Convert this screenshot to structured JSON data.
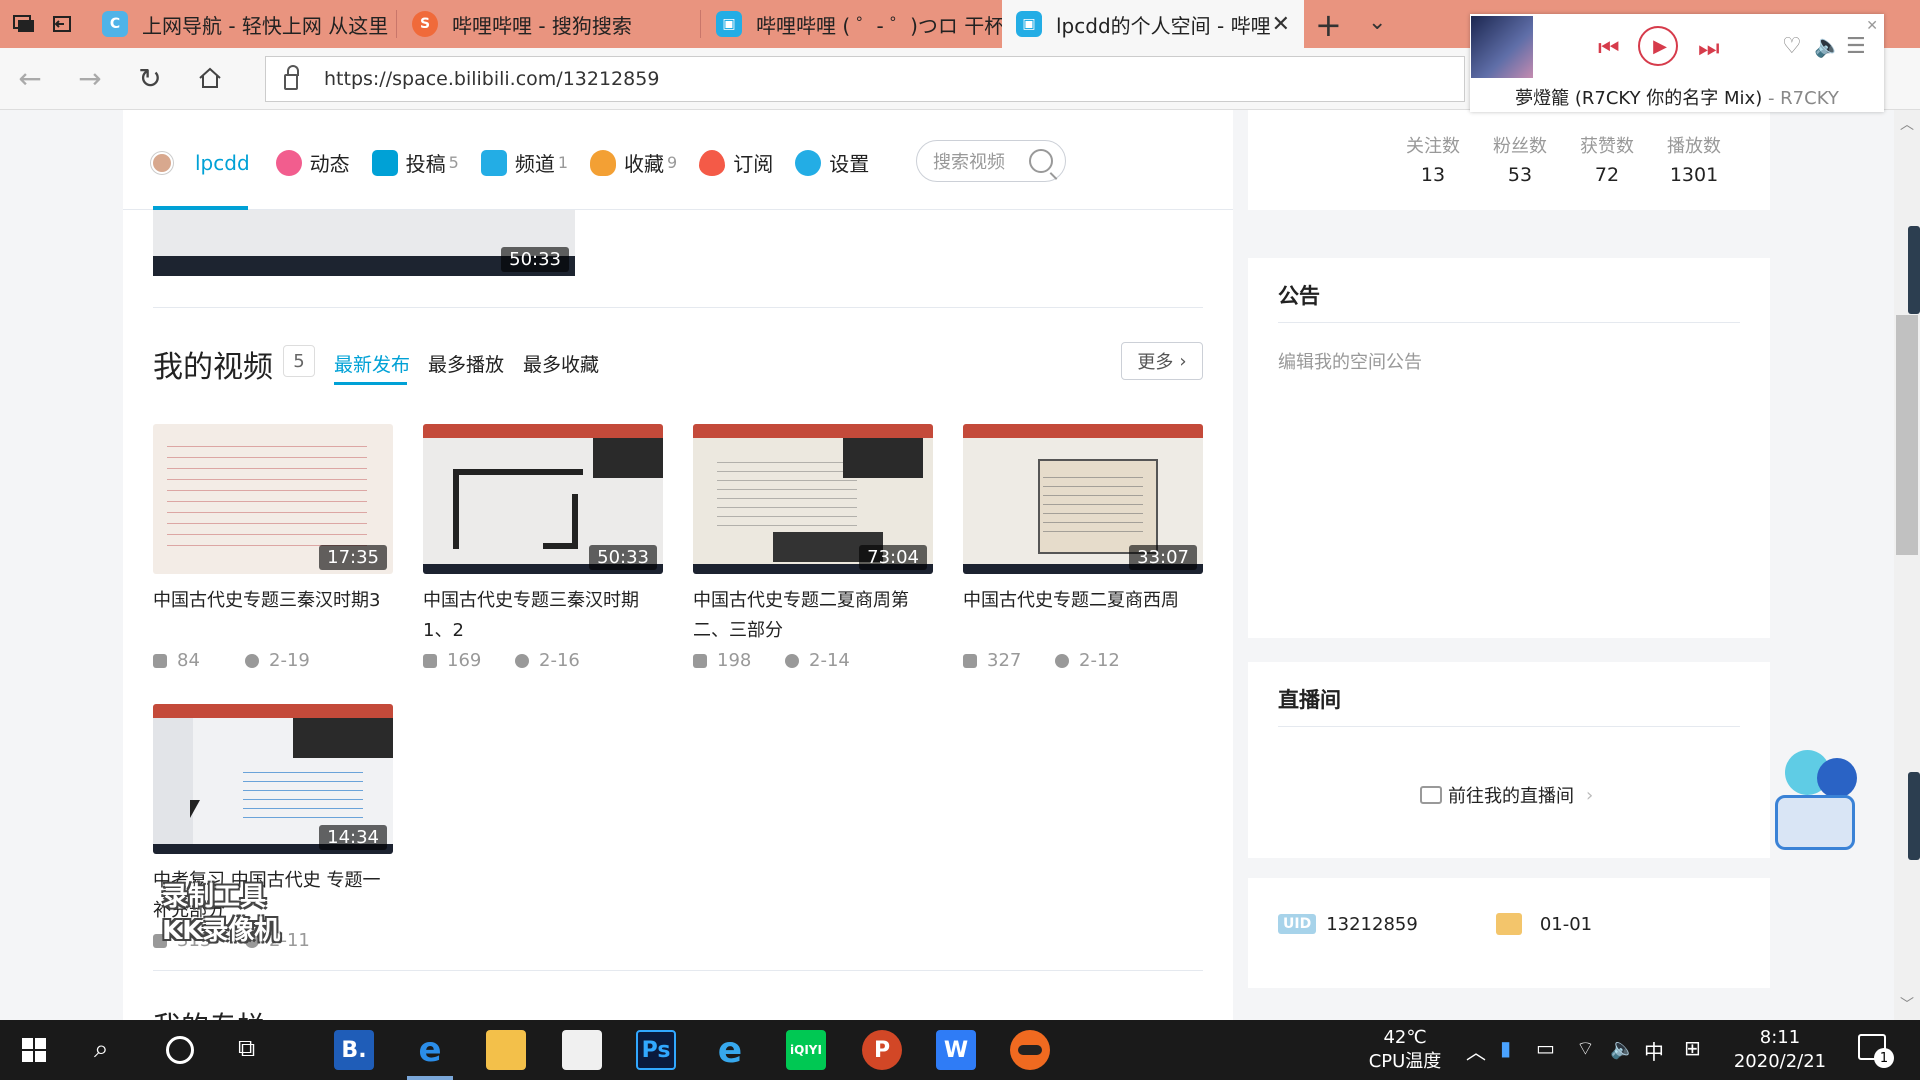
{
  "browser": {
    "tabs": [
      {
        "title": "上网导航 - 轻快上网 从这里",
        "active": false
      },
      {
        "title": "哔哩哔哩 - 搜狗搜索",
        "active": false
      },
      {
        "title": "哔哩哔哩 ( ゜- ゜)つロ 干杯~",
        "active": false
      },
      {
        "title": "lpcdd的个人空间 - 哔哩",
        "active": true
      }
    ],
    "url": "https://space.bilibili.com/13212859"
  },
  "player": {
    "song": "夢燈籠 (R7CKY 你的名字 Mix)",
    "separator": " - ",
    "artist": "R7CKY"
  },
  "header": {
    "username": "lpcdd",
    "nav": [
      {
        "label": "动态",
        "count": "",
        "icon": "dynamic-icon",
        "color": "#f25d8e"
      },
      {
        "label": "投稿",
        "count": "5",
        "icon": "upload-icon",
        "color": "#00a1d6"
      },
      {
        "label": "频道",
        "count": "1",
        "icon": "channel-icon",
        "color": "#23ade5"
      },
      {
        "label": "收藏",
        "count": "9",
        "icon": "favorite-icon",
        "color": "#f3a034"
      },
      {
        "label": "订阅",
        "count": "",
        "icon": "subscribe-icon",
        "color": "#f45a47"
      },
      {
        "label": "设置",
        "count": "",
        "icon": "settings-icon",
        "color": "#23ade5"
      }
    ],
    "search_placeholder": "搜索视频"
  },
  "stats": [
    {
      "label": "关注数",
      "value": "13"
    },
    {
      "label": "粉丝数",
      "value": "53"
    },
    {
      "label": "获赞数",
      "value": "72"
    },
    {
      "label": "播放数",
      "value": "1301"
    }
  ],
  "top_video": {
    "duration": "50:33"
  },
  "videos_section": {
    "title": "我的视频",
    "count": "5",
    "tabs": [
      "最新发布",
      "最多播放",
      "最多收藏"
    ],
    "more": "更多"
  },
  "videos": [
    {
      "title": "中国古代史专题三秦汉时期3",
      "duration": "17:35",
      "plays": "84",
      "date": "2-19"
    },
    {
      "title": "中国古代史专题三秦汉时期1、2",
      "duration": "50:33",
      "plays": "169",
      "date": "2-16"
    },
    {
      "title": "中国古代史专题二夏商周第二、三部分",
      "duration": "73:04",
      "plays": "198",
      "date": "2-14"
    },
    {
      "title": "中国古代史专题二夏商西周",
      "duration": "33:07",
      "plays": "327",
      "date": "2-12"
    },
    {
      "title": "中考复习 中国古代史 专题一补充部分",
      "duration": "14:34",
      "plays": "313",
      "date": "2-11"
    }
  ],
  "next_section_title": "我的专栏",
  "announcement": {
    "title": "公告",
    "hint": "编辑我的空间公告"
  },
  "live": {
    "title": "直播间",
    "link": "前往我的直播间"
  },
  "info": {
    "uid_tag": "UID",
    "uid": "13212859",
    "birthday": "01-01"
  },
  "watermark": {
    "line1": "录制工具",
    "line2": "KK录像机"
  },
  "taskbar": {
    "apps": [
      "B.",
      "e",
      "",
      "",
      "Ps",
      "e",
      "iQIYI",
      "P",
      "W",
      ""
    ],
    "temp": "42℃",
    "temp_label": "CPU温度",
    "ime": "中",
    "time": "8:11",
    "date": "2020/2/21",
    "notifications": "1"
  }
}
